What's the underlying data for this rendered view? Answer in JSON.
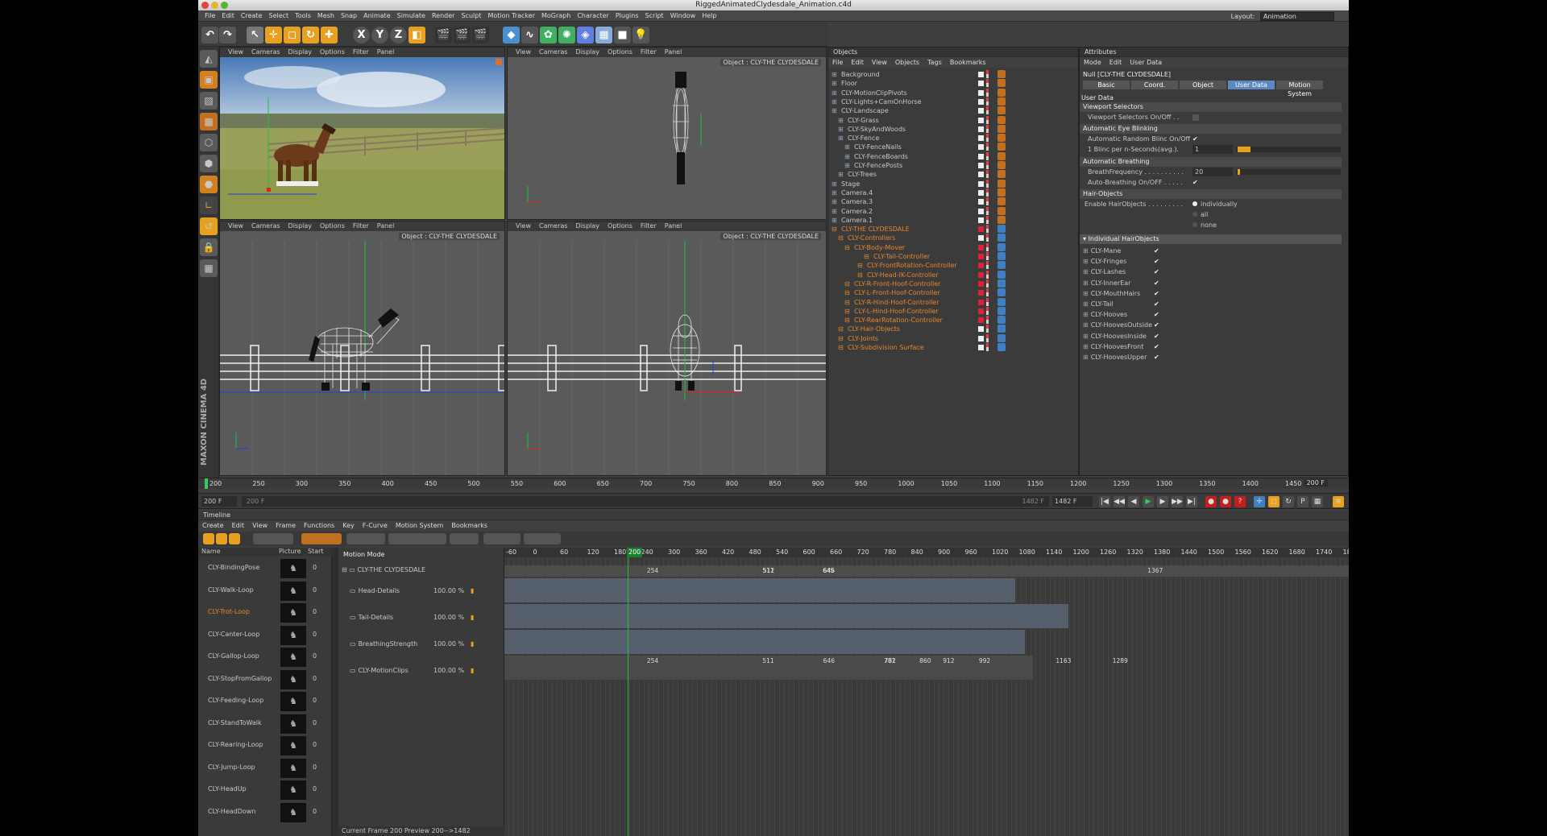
{
  "window": {
    "title": "RiggedAnimatedClydesdale_Animation.c4d"
  },
  "menu": [
    "File",
    "Edit",
    "Create",
    "Select",
    "Tools",
    "Mesh",
    "Snap",
    "Animate",
    "Simulate",
    "Render",
    "Sculpt",
    "Motion Tracker",
    "MoGraph",
    "Character",
    "Plugins",
    "Script",
    "Window",
    "Help"
  ],
  "layout": {
    "label": "Layout:",
    "value": "Animation"
  },
  "toolbar": {
    "x": "X",
    "y": "Y",
    "z": "Z"
  },
  "viewport_menu": [
    "View",
    "Cameras",
    "Display",
    "Options",
    "Filter",
    "Panel"
  ],
  "viewports": [
    {
      "label": ""
    },
    {
      "label": "Object : CLY-THE CLYDESDALE"
    },
    {
      "label": "Object : CLY-THE CLYDESDALE"
    },
    {
      "label": "Object : CLY-THE CLYDESDALE"
    }
  ],
  "brand": "MAXON CINEMA 4D",
  "objects": {
    "title": "Objects",
    "menu": [
      "File",
      "Edit",
      "View",
      "Objects",
      "Tags",
      "Bookmarks"
    ],
    "items": [
      {
        "name": "Background",
        "indent": 0,
        "orange": false,
        "red": false
      },
      {
        "name": "Floor",
        "indent": 0,
        "orange": false,
        "red": false
      },
      {
        "name": "CLY-MotionClipPivots",
        "indent": 0,
        "orange": false,
        "red": false
      },
      {
        "name": "CLY-Lights+CamOnHorse",
        "indent": 0,
        "orange": false,
        "red": false
      },
      {
        "name": "CLY-Landscape",
        "indent": 0,
        "orange": false,
        "red": false
      },
      {
        "name": "CLY-Grass",
        "indent": 1,
        "orange": false,
        "red": false
      },
      {
        "name": "CLY-SkyAndWoods",
        "indent": 1,
        "orange": false,
        "red": false
      },
      {
        "name": "CLY-Fence",
        "indent": 1,
        "orange": false,
        "red": false
      },
      {
        "name": "CLY-FenceNails",
        "indent": 2,
        "orange": false,
        "red": false
      },
      {
        "name": "CLY-FenceBoards",
        "indent": 2,
        "orange": false,
        "red": false
      },
      {
        "name": "CLY-FencePosts",
        "indent": 2,
        "orange": false,
        "red": false
      },
      {
        "name": "CLY-Trees",
        "indent": 1,
        "orange": false,
        "red": false
      },
      {
        "name": "Stage",
        "indent": 0,
        "orange": false,
        "red": false
      },
      {
        "name": "Camera.4",
        "indent": 0,
        "orange": false,
        "red": false
      },
      {
        "name": "Camera.3",
        "indent": 0,
        "orange": false,
        "red": false
      },
      {
        "name": "Camera.2",
        "indent": 0,
        "orange": false,
        "red": false
      },
      {
        "name": "Camera.1",
        "indent": 0,
        "orange": false,
        "red": false
      },
      {
        "name": "CLY-THE CLYDESDALE",
        "indent": 0,
        "orange": true,
        "red": true
      },
      {
        "name": "CLY-Controllers",
        "indent": 1,
        "orange": true,
        "red": false
      },
      {
        "name": "CLY-Body-Mover",
        "indent": 2,
        "orange": true,
        "red": true
      },
      {
        "name": "CLY-Tail-Controller",
        "indent": 5,
        "orange": true,
        "red": true
      },
      {
        "name": "CLY-FrontRotation-Controller",
        "indent": 4,
        "orange": true,
        "red": true
      },
      {
        "name": "CLY-Head-IK-Controller",
        "indent": 4,
        "orange": true,
        "red": true
      },
      {
        "name": "CLY-R-Front-Hoof-Controller",
        "indent": 2,
        "orange": true,
        "red": true
      },
      {
        "name": "CLY-L-Front-Hoof-Controller",
        "indent": 2,
        "orange": true,
        "red": true
      },
      {
        "name": "CLY-R-Hind-Hoof-Controller",
        "indent": 2,
        "orange": true,
        "red": true
      },
      {
        "name": "CLY-L-Hind-Hoof-Controller",
        "indent": 2,
        "orange": true,
        "red": true
      },
      {
        "name": "CLY-RearRotation-Controller",
        "indent": 2,
        "orange": true,
        "red": true
      },
      {
        "name": "CLY-Hair-Objects",
        "indent": 1,
        "orange": true,
        "red": false
      },
      {
        "name": "CLY-Joints",
        "indent": 1,
        "orange": true,
        "red": false
      },
      {
        "name": "CLY-Subdivision Surface",
        "indent": 1,
        "orange": true,
        "red": false
      }
    ]
  },
  "attributes": {
    "title": "Attributes",
    "menu": [
      "Mode",
      "Edit",
      "User Data"
    ],
    "object_name": "Null [CLY-THE CLYDESDALE]",
    "tabs": [
      "Basic",
      "Coord.",
      "Object",
      "User Data",
      "Motion System"
    ],
    "active_tab": "User Data",
    "section_user_data": "User Data",
    "viewport_selectors": "Viewport Selectors",
    "viewport_selectors_onoff": "Viewport Selectors On/Off . .",
    "eye_blinking": "Automatic Eye Blinking",
    "random_blinc": "Automatic Random Blinc On/Off",
    "blinc_seconds": "1 Blinc per n-Seconds(avg.).",
    "blinc_value": "1",
    "breathing": "Automatic Breathing",
    "breath_freq": "BreathFrequency . . . . . . . . . .",
    "breath_value": "20",
    "auto_breathing": "Auto-Breathing On/OFF . . . . .",
    "hair_objects": "Hair-Objects",
    "enable_hair": "Enable HairObjects . . . . . . . . .",
    "radio": [
      "individually",
      "all",
      "none"
    ],
    "individual_hair": "Individual HairObjects",
    "hair_items": [
      "CLY-Mane",
      "CLY-Fringes",
      "CLY-Lashes",
      "CLY-InnerEar",
      "CLY-MouthHairs",
      "CLY-Tail",
      "CLY-Hooves",
      "CLY-HoovesOutside",
      "CLY-HoovesInside",
      "CLY-HoovesFront",
      "CLY-HoovesUpper"
    ]
  },
  "ruler": {
    "ticks": [
      "200",
      "250",
      "300",
      "350",
      "400",
      "450",
      "500",
      "550",
      "600",
      "650",
      "700",
      "750",
      "800",
      "850",
      "900",
      "950",
      "1000",
      "1050",
      "1100",
      "1150",
      "1200",
      "1250",
      "1300",
      "1350",
      "1400",
      "1450"
    ],
    "frame": "200 F"
  },
  "transport": {
    "start": "200 F",
    "range_start": "200 F",
    "range_end": "1482 F",
    "end": "1482 F"
  },
  "timeline": {
    "title": "Timeline",
    "menu": [
      "Create",
      "Edit",
      "View",
      "Frame",
      "Functions",
      "Key",
      "F-Curve",
      "Motion System",
      "Bookmarks"
    ],
    "columns": [
      "Name",
      "Picture",
      "Start"
    ],
    "clips": [
      {
        "name": "CLY-BindingPose",
        "start": "0",
        "active": false
      },
      {
        "name": "CLY-Walk-Loop",
        "start": "0",
        "active": false
      },
      {
        "name": "CLY-Trot-Loop",
        "start": "0",
        "active": true
      },
      {
        "name": "CLY-Canter-Loop",
        "start": "0",
        "active": false
      },
      {
        "name": "CLY-Gallop-Loop",
        "start": "0",
        "active": false
      },
      {
        "name": "CLY-StopFromGallop",
        "start": "0",
        "active": false
      },
      {
        "name": "CLY-Feeding-Loop",
        "start": "0",
        "active": false
      },
      {
        "name": "CLY-StandToWalk",
        "start": "0",
        "active": false
      },
      {
        "name": "CLY-Rearing-Loop",
        "start": "0",
        "active": false
      },
      {
        "name": "CLY-Jump-Loop",
        "start": "0",
        "active": false
      },
      {
        "name": "CLY-HeadUp",
        "start": "0",
        "active": false
      },
      {
        "name": "CLY-HeadDown",
        "start": "0",
        "active": false
      }
    ],
    "motion_mode": "Motion Mode",
    "group": "CLY-THE CLYDESDALE",
    "layers": [
      {
        "name": "Head-Details",
        "pct": "100.00 %"
      },
      {
        "name": "Tail-Details",
        "pct": "100.00 %"
      },
      {
        "name": "BreathingStrength",
        "pct": "100.00 %"
      },
      {
        "name": "CLY-MotionClips",
        "pct": "100.00 %"
      }
    ],
    "scale": [
      "-60",
      "0",
      "60",
      "120",
      "180",
      "240",
      "300",
      "360",
      "420",
      "480",
      "540",
      "600",
      "660",
      "720",
      "780",
      "840",
      "900",
      "960",
      "1020",
      "1080",
      "1140",
      "1200",
      "1260",
      "1320",
      "1380",
      "1440",
      "1500",
      "1560",
      "1620",
      "1680",
      "1740",
      "1800"
    ],
    "current_marker": "200",
    "group_keys": [
      "254",
      "511",
      "512",
      "645",
      "646",
      "1367"
    ],
    "clip_keys": [
      "254",
      "511",
      "646",
      "781",
      "782",
      "860",
      "912",
      "992",
      "1163",
      "1289"
    ],
    "status": "Current Frame  200  Preview  200-->1482"
  }
}
